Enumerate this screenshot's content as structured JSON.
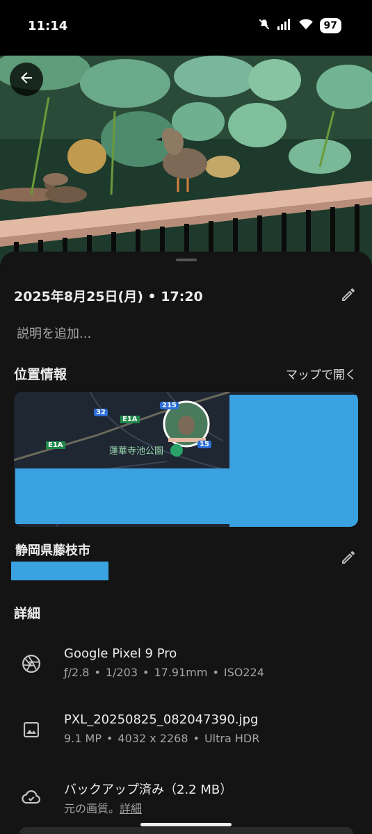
{
  "status_bar": {
    "time": "11:14",
    "battery": "97"
  },
  "photo": {
    "subject": ""
  },
  "sheet": {
    "datetime": "2025年8月25日(月) • 17:20",
    "description_placeholder": "説明を追加...",
    "location_title": "位置情報",
    "open_map_label": "マップで開く",
    "map": {
      "labels": {
        "route_32": "32",
        "route_215": "215",
        "route_e1a_1": "E1A",
        "route_e1a_2": "E1A",
        "park": "蓮華寺池公園",
        "route_partial": "15"
      }
    },
    "place_name": "静岡県藤枝市",
    "details_title": "詳細",
    "details": [
      {
        "icon": "camera-aperture-icon",
        "main": "Google Pixel 9 Pro",
        "sub": [
          "ƒ/2.8",
          "1/203",
          "17.91mm",
          "ISO224"
        ]
      },
      {
        "icon": "image-icon",
        "main": "PXL_20250825_082047390.jpg",
        "sub": [
          "9.1 MP",
          "4032 x 2268",
          "Ultra HDR"
        ]
      },
      {
        "icon": "cloud-done-icon",
        "main": "バックアップ済み（2.2 MB）",
        "sub_text": "元の画質。",
        "sub_link": "詳細"
      }
    ]
  },
  "colors": {
    "sheet_bg": "#141414",
    "redaction": "#3aa2e0",
    "map_bg": "#1f2733"
  }
}
